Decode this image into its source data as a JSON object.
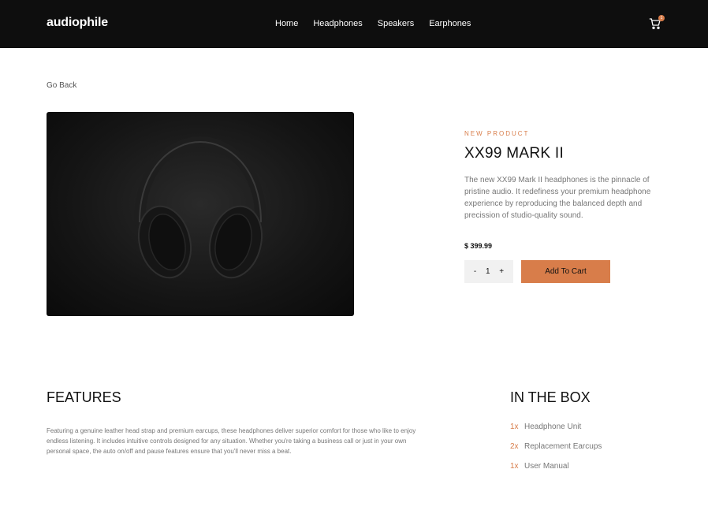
{
  "header": {
    "logo": "audiophile",
    "nav": [
      "Home",
      "Headphones",
      "Speakers",
      "Earphones"
    ],
    "cart_count": "1"
  },
  "go_back": "Go Back",
  "product": {
    "overline": "NEW PRODUCT",
    "title": "XX99 MARK II",
    "description": "The new XX99 Mark II headphones is the pinnacle of pristine audio. It redefiness your premium headphone experience by reproducing the balanced depth and precission of studio-quality sound.",
    "price": "$ 399.99",
    "quantity": {
      "minus": "-",
      "value": "1",
      "plus": "+"
    },
    "add_to_cart": "Add To Cart"
  },
  "features": {
    "title": "FEATURES",
    "text": "Featuring a genuine leather head strap and premium earcups, these headphones deliver superior comfort for those who like to enjoy endless listening. It includes intuitive controls designed for any situation. Whether you're taking a business call or just in your own personal space, the auto on/off and pause features ensure that you'll never miss a beat."
  },
  "in_the_box": {
    "title": "IN THE BOX",
    "items": [
      {
        "qty": "1x",
        "name": "Headphone Unit"
      },
      {
        "qty": "2x",
        "name": "Replacement Earcups"
      },
      {
        "qty": "1x",
        "name": "User Manual"
      }
    ]
  },
  "colors": {
    "accent": "#d87d4a",
    "header_bg": "#0e0e0e"
  }
}
